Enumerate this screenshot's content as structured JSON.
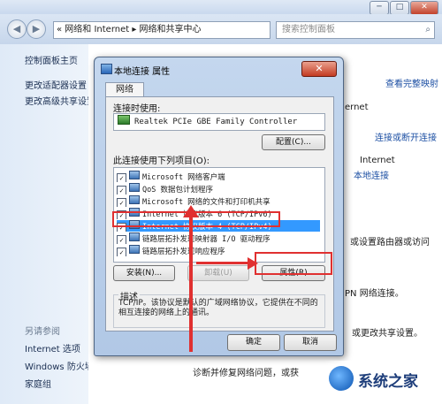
{
  "window": {
    "minimize": "─",
    "maximize": "□",
    "close": "✕"
  },
  "nav": {
    "back": "◀",
    "forward": "▶"
  },
  "address": {
    "crumbs": "« 网络和 Internet ▸ 网络和共享中心",
    "placeholder": "搜索控制面板"
  },
  "sidebar": {
    "home": "控制面板主页",
    "links": [
      "更改适配器设置",
      "更改高级共享设置"
    ],
    "see_also_heading": "另请参阅",
    "see_also": [
      "Internet 选项",
      "Windows 防火墙",
      "家庭组"
    ]
  },
  "main": {
    "full_map": "查看完整映射",
    "internet_suffix": "ernet",
    "connect_disconnect": "连接或断开连接",
    "internet_label": "Internet",
    "local_connection": "本地连接",
    "router_text": "或设置路由器或访问",
    "pn_text": "PN 网络连接。",
    "share_text": "或更改共享设置。",
    "diagnose_text": "诊断并修复网络问题，或获"
  },
  "dialog": {
    "title": "本地连接 属性",
    "close": "✕",
    "tab": "网络",
    "connect_using_label": "连接时使用:",
    "adapter": "Realtek PCIe GBE Family Controller",
    "configure_button": "配置(C)...",
    "items_label": "此连接使用下列项目(O):",
    "items": [
      {
        "label": "Microsoft 网络客户端",
        "checked": true
      },
      {
        "label": "QoS 数据包计划程序",
        "checked": true
      },
      {
        "label": "Microsoft 网络的文件和打印机共享",
        "checked": true
      },
      {
        "label": "Internet 协议版本 6 (TCP/IPv6)",
        "checked": true
      },
      {
        "label": "Internet 协议版本 4 (TCP/IPv4)",
        "checked": true,
        "selected": true
      },
      {
        "label": "链路层拓扑发现映射器 I/O 驱动程序",
        "checked": true
      },
      {
        "label": "链路层拓扑发现响应程序",
        "checked": true
      }
    ],
    "install_button": "安装(N)...",
    "uninstall_button": "卸载(U)",
    "properties_button": "属性(R)",
    "description_label": "描述",
    "description_text": "TCP/IP。该协议是默认的广域网络协议，它提供在不同的相互连接的网络上的通讯。",
    "ok_button": "确定",
    "cancel_button": "取消"
  },
  "watermark": {
    "brand": "系统之家"
  },
  "colors": {
    "highlight": "#e03030",
    "selection": "#3399ff",
    "link": "#1c4fa3"
  }
}
